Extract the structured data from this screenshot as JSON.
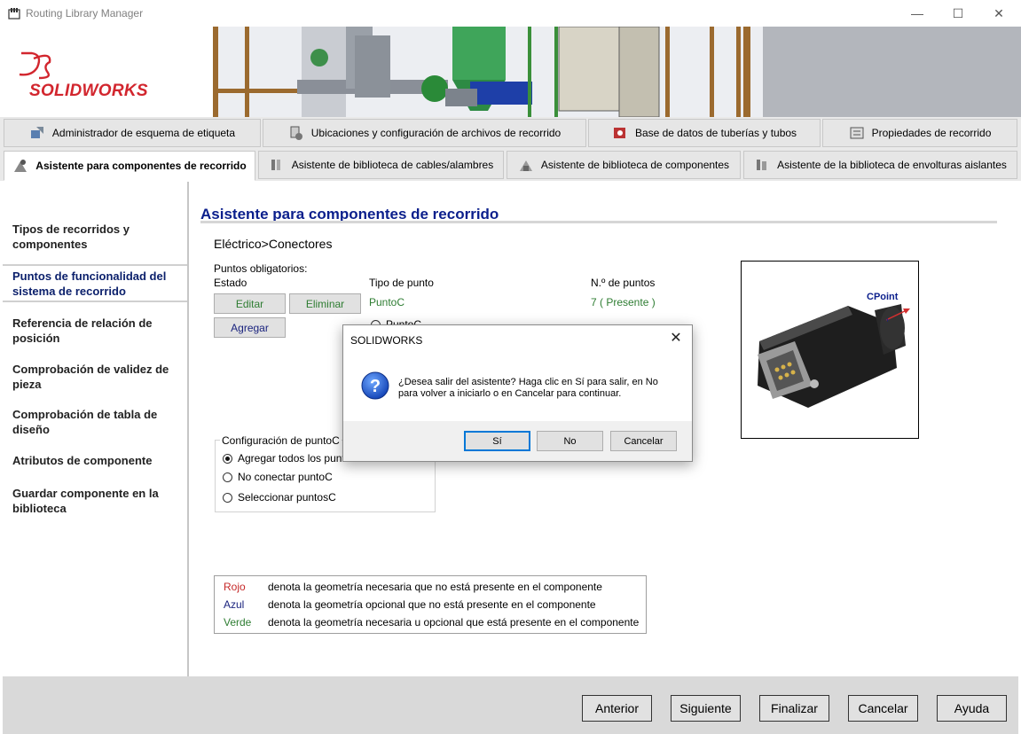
{
  "window": {
    "title": "Routing Library Manager",
    "controls": [
      "minimize-icon",
      "maximize-icon",
      "close-icon"
    ]
  },
  "brand": {
    "logo_text": "SOLIDWORKS",
    "color": "#d2262e"
  },
  "tabs_row1": [
    {
      "label": "Administrador de esquema de etiqueta",
      "icon": "tag-schema-icon"
    },
    {
      "label": "Ubicaciones y configuración de archivos de recorrido",
      "icon": "file-locations-icon"
    },
    {
      "label": "Base de datos de tuberías y tubos",
      "icon": "database-icon"
    },
    {
      "label": "Propiedades de recorrido",
      "icon": "properties-icon"
    }
  ],
  "tabs_row2": [
    {
      "label": "Asistente para componentes de recorrido",
      "icon": "wizard-icon",
      "active": true
    },
    {
      "label": "Asistente de biblioteca de cables/alambres",
      "icon": "cable-library-icon"
    },
    {
      "label": "Asistente de biblioteca de componentes",
      "icon": "component-library-icon"
    },
    {
      "label": "Asistente de la biblioteca de envolturas aislantes",
      "icon": "covering-library-icon"
    }
  ],
  "sidebar": {
    "items": [
      {
        "label": "Tipos de recorridos y componentes"
      },
      {
        "label": "Puntos de funcionalidad del sistema de recorrido",
        "active": true
      },
      {
        "label": "Referencia de relación de posición"
      },
      {
        "label": "Comprobación de validez de pieza"
      },
      {
        "label": "Comprobación de tabla de diseño"
      },
      {
        "label": "Atributos de componente"
      },
      {
        "label": "Guardar componente en la biblioteca"
      }
    ]
  },
  "main": {
    "title": "Asistente para componentes de recorrido",
    "breadcrumb": "Eléctrico>Conectores",
    "required_points_label": "Puntos obligatorios:",
    "col_status": "Estado",
    "col_point_type": "Tipo de punto",
    "col_count": "N.º de puntos",
    "row_point_type": "PuntoC",
    "row_count": "7 ( Presente )",
    "edit_label": "Editar",
    "delete_label": "Eliminar",
    "add_label": "Agregar",
    "partial_radio_label": "PuntoC",
    "config_group_label": "Configuración de puntoC",
    "config_options": [
      {
        "label": "Agregar todos los puntosC",
        "checked": true
      },
      {
        "label": "No conectar puntoC",
        "checked": false
      },
      {
        "label": "Seleccionar puntosC",
        "checked": false
      }
    ],
    "preview_label": "CPoint",
    "legend": [
      {
        "key": "Rojo",
        "desc": "denota la geometría necesaria que no está presente en el componente",
        "color": "#c62828"
      },
      {
        "key": "Azul",
        "desc": "denota la geometría opcional que no está presente en el componente",
        "color": "#1a237e"
      },
      {
        "key": "Verde",
        "desc": "denota la geometría necesaria u opcional que está presente en el componente",
        "color": "#2e7d32"
      }
    ]
  },
  "footer": {
    "back": "Anterior",
    "next": "Siguiente",
    "finish": "Finalizar",
    "cancel": "Cancelar",
    "help": "Ayuda"
  },
  "dialog": {
    "title": "SOLIDWORKS",
    "message_line1": "¿Desea salir del asistente? Haga clic en Sí para salir, en No",
    "message_line2": "para volver a iniciarlo o en Cancelar para continuar.",
    "yes": "Sí",
    "no": "No",
    "cancel": "Cancelar",
    "icon": "question-icon"
  }
}
